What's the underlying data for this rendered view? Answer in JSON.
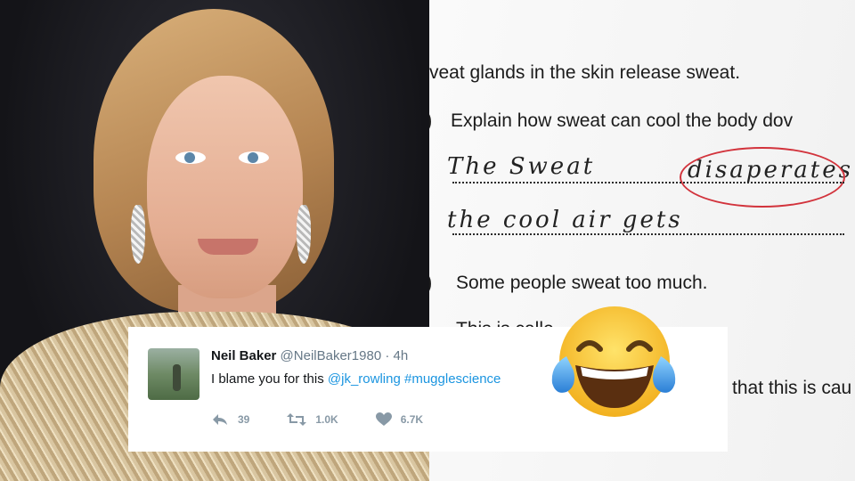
{
  "worksheet": {
    "line1": "veat glands in the skin release sweat.",
    "q1_number": ")",
    "q1_text": "Explain how sweat can cool the body dov",
    "handwriting_line1_a": "The Sweat",
    "handwriting_line1_b": "disaperates",
    "handwriting_line2": "the cool air gets",
    "q2_number": ")",
    "q2_text": "Some people sweat too much.",
    "line4_partial": "This is calle",
    "line5_partial": "that this is cau"
  },
  "tweet": {
    "display_name": "Neil Baker",
    "handle": "@NeilBaker1980",
    "separator": "·",
    "time": "4h",
    "text_plain": "I blame you for this ",
    "mention": "@jk_rowling",
    "hashtag": "#mugglescience",
    "reply_count": "39",
    "retweet_count": "1.0K",
    "like_count": "6.7K"
  },
  "icons": {
    "reply": "reply-icon",
    "retweet": "retweet-icon",
    "like": "heart-icon",
    "emoji": "tears-of-joy-emoji"
  },
  "colors": {
    "link": "#1b95e0",
    "muted": "#8899a6",
    "correction_pen": "#d2333c"
  }
}
